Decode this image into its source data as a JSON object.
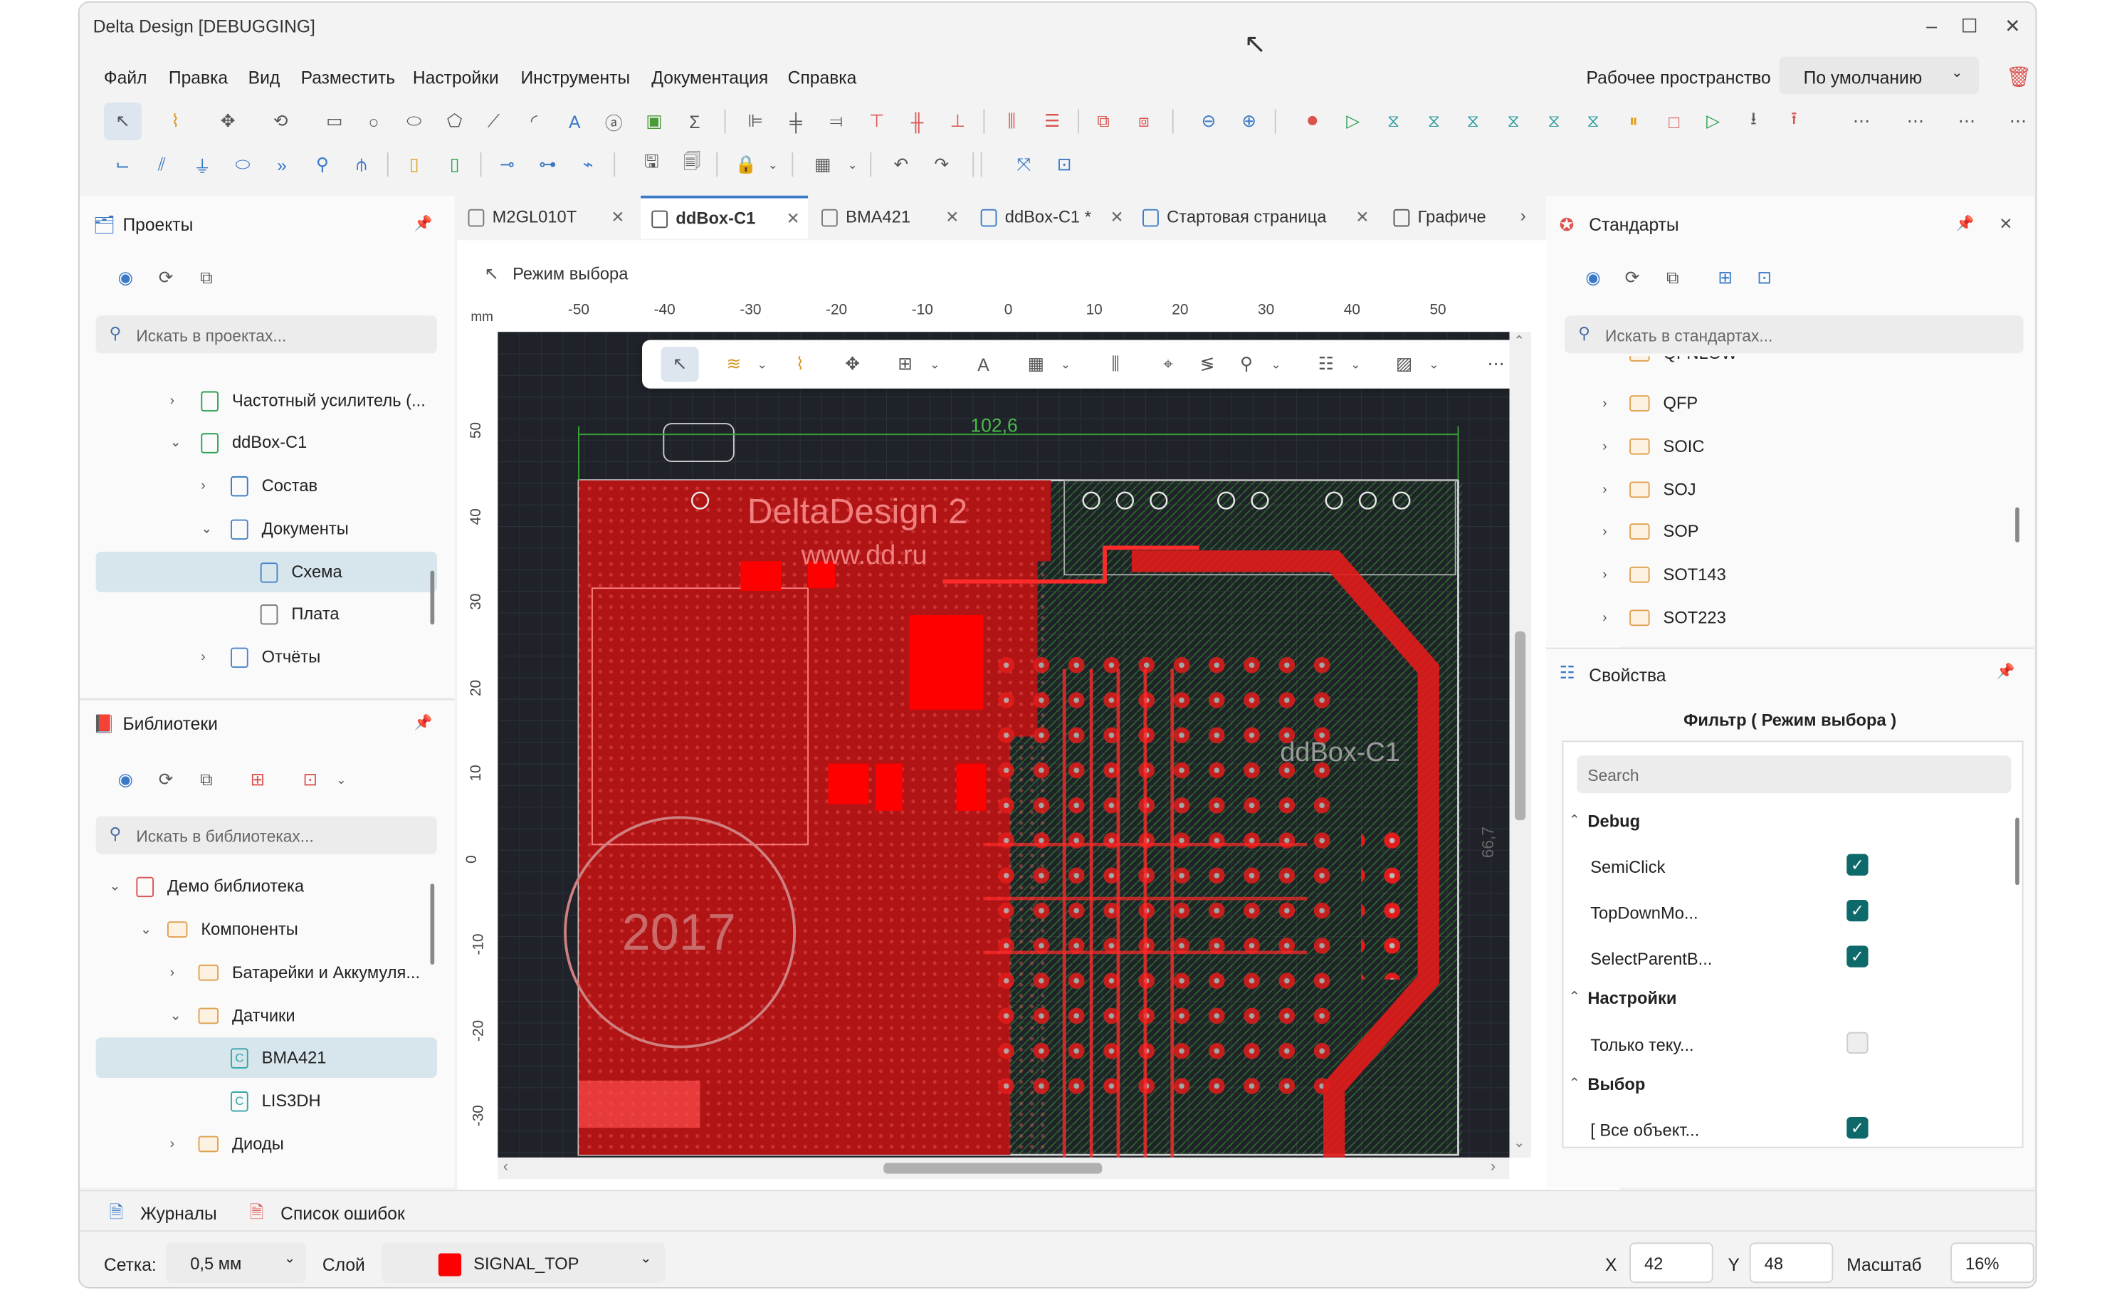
{
  "window": {
    "title": "Delta Design [DEBUGGING]",
    "minimize": "–",
    "maximize": "☐",
    "close": "✕"
  },
  "menu": [
    "Файл",
    "Правка",
    "Вид",
    "Разместить",
    "Настройки",
    "Инструменты",
    "Документация",
    "Справка"
  ],
  "workspace": {
    "label": "Рабочее пространство",
    "value": "По умолчанию"
  },
  "projects": {
    "title": "Проекты",
    "search_placeholder": "Искать в проектах...",
    "items": [
      {
        "label": "Частотный усилитель (..."
      },
      {
        "label": "ddBox-C1"
      },
      {
        "label": "Состав"
      },
      {
        "label": "Документы"
      },
      {
        "label": "Схема"
      },
      {
        "label": "Плата"
      },
      {
        "label": "Отчёты"
      }
    ]
  },
  "libraries": {
    "title": "Библиотеки",
    "search_placeholder": "Искать в библиотеках...",
    "items": [
      {
        "label": "Демо библиотека"
      },
      {
        "label": "Компоненты"
      },
      {
        "label": "Батарейки и Аккумуля..."
      },
      {
        "label": "Датчики"
      },
      {
        "label": "BMA421"
      },
      {
        "label": "LIS3DH"
      },
      {
        "label": "Диоды"
      }
    ]
  },
  "tabs": [
    {
      "label": "M2GL010T"
    },
    {
      "label": "ddBox-C1"
    },
    {
      "label": "BMA421"
    },
    {
      "label": "ddBox-C1 *"
    },
    {
      "label": "Стартовая страница"
    },
    {
      "label": "Графиче"
    }
  ],
  "mode_label": "Режим выбора",
  "ruler": {
    "unit": "mm",
    "x": [
      "-50",
      "-40",
      "-30",
      "-20",
      "-10",
      "0",
      "10",
      "20",
      "30",
      "40",
      "50"
    ],
    "y": [
      "50",
      "40",
      "30",
      "20",
      "10",
      "0",
      "-10",
      "-20",
      "-30"
    ]
  },
  "board": {
    "dimension": "102,6",
    "text1": "DeltaDesign 2",
    "text2": "www.dd.ru",
    "text3": "ddBox-C1",
    "text4": "2017",
    "side_dim": "66,7"
  },
  "standards": {
    "title": "Стандарты",
    "search_placeholder": "Искать в стандартах...",
    "items": [
      {
        "label": "QFNLOW"
      },
      {
        "label": "QFP"
      },
      {
        "label": "SOIC"
      },
      {
        "label": "SOJ"
      },
      {
        "label": "SOP"
      },
      {
        "label": "SOT143"
      },
      {
        "label": "SOT223"
      }
    ]
  },
  "properties": {
    "title": "Свойства",
    "filter_title": "Фильтр ( Режим выбора )",
    "search_placeholder": "Search",
    "sections": [
      {
        "name": "Debug",
        "rows": [
          {
            "label": "SemiClick",
            "checked": true
          },
          {
            "label": "TopDownMo...",
            "checked": true
          },
          {
            "label": "SelectParentB...",
            "checked": true
          }
        ]
      },
      {
        "name": "Настройки",
        "rows": [
          {
            "label": "Только теку...",
            "checked": false
          }
        ]
      },
      {
        "name": "Выбор",
        "rows": [
          {
            "label": "[ Все объект...",
            "checked": true
          }
        ]
      }
    ]
  },
  "bottom_tabs": {
    "logs": "Журналы",
    "errors": "Список ошибок"
  },
  "status": {
    "grid_label": "Сетка:",
    "grid_value": "0,5 мм",
    "layer_label": "Слой",
    "layer_value": "SIGNAL_TOP",
    "layer_color": "#ff0000",
    "x_label": "X",
    "x_value": "42",
    "y_label": "Y",
    "y_value": "48",
    "scale_label": "Масштаб",
    "scale_value": "16%"
  },
  "colors": {
    "accent": "#0e6a6a",
    "board_bg": "#1f2329",
    "copper": "#e21b1b"
  }
}
